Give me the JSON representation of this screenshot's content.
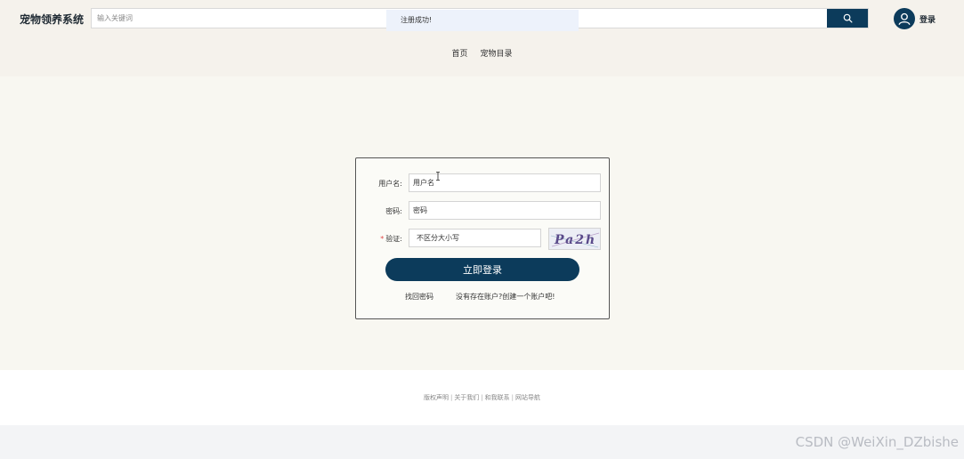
{
  "header": {
    "brand": "宠物领养系统",
    "search": {
      "placeholder": "输入关键词",
      "value": ""
    },
    "search_icon": "search-icon",
    "toast": "注册成功!",
    "user": {
      "avatar_icon": "user-icon",
      "login_label": "登录"
    }
  },
  "nav": {
    "items": [
      {
        "label": "首页"
      },
      {
        "label": "宠物目录"
      }
    ]
  },
  "login_form": {
    "username": {
      "label": "用户名:",
      "placeholder": "用户名"
    },
    "password": {
      "label": "密码:",
      "placeholder": "密码"
    },
    "captcha": {
      "required_mark": "*",
      "label": "验证:",
      "placeholder": "不区分大小写",
      "code": "Pa2h"
    },
    "submit_label": "立即登录",
    "forgot_label": "找回密码",
    "register_label": "没有存在账户?创建一个账户吧!"
  },
  "footer": {
    "links": [
      "版权声明",
      "关于我们",
      "和我联系",
      "网站导航"
    ]
  },
  "watermark": "CSDN @WeiXin_DZbishe",
  "colors": {
    "primary": "#0c3b5b",
    "header_bg": "#f5f2ec",
    "main_bg": "#f8f7f1",
    "toast_bg": "#edf2fb",
    "required": "#e24b4b"
  }
}
